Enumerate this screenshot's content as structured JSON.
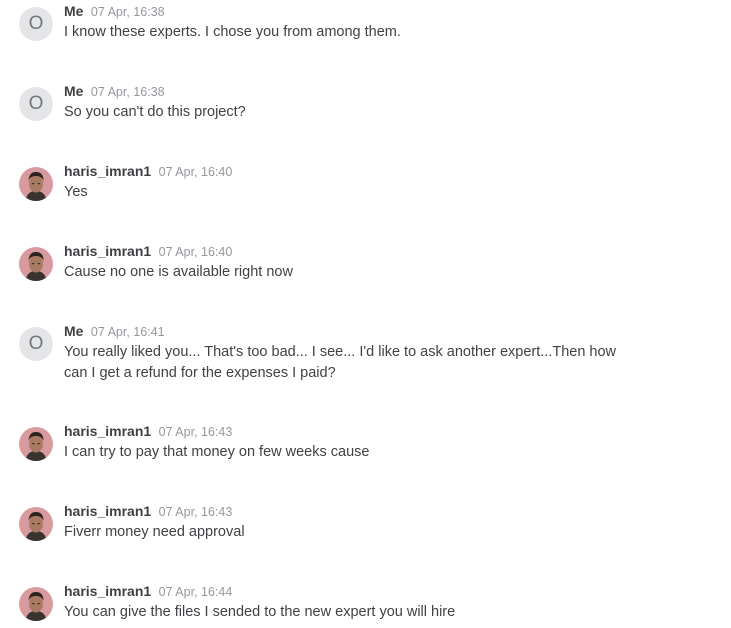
{
  "messages": [
    {
      "sender": "Me",
      "avatar_initial": "O",
      "time": "07 Apr, 16:38",
      "text": "I know these experts. I chose you from among them."
    },
    {
      "sender": "Me",
      "avatar_initial": "O",
      "time": "07 Apr, 16:38",
      "text": "So you can't do this project?"
    },
    {
      "sender": "haris_imran1",
      "avatar_icon": "user-photo",
      "time": "07 Apr, 16:40",
      "text": "Yes"
    },
    {
      "sender": "haris_imran1",
      "avatar_icon": "user-photo",
      "time": "07 Apr, 16:40",
      "text": "Cause no one is available right now"
    },
    {
      "sender": "Me",
      "avatar_initial": "O",
      "time": "07 Apr, 16:41",
      "text": "You really liked you... That's too bad... I see... I'd like to ask another expert...Then how can I get a refund for the expenses I paid?"
    },
    {
      "sender": "haris_imran1",
      "avatar_icon": "user-photo",
      "time": "07 Apr, 16:43",
      "text": "I can try to pay that money on few weeks cause"
    },
    {
      "sender": "haris_imran1",
      "avatar_icon": "user-photo",
      "time": "07 Apr, 16:43",
      "text": "Fiverr money need approval"
    },
    {
      "sender": "haris_imran1",
      "avatar_icon": "user-photo",
      "time": "07 Apr, 16:44",
      "text": "You can give the files I sended to the new expert you will hire"
    }
  ],
  "colors": {
    "name": "#404145",
    "time": "#95979d",
    "text": "#404145",
    "initial_avatar_bg": "#e4e5e7",
    "initial_avatar_fg": "#74767e"
  }
}
